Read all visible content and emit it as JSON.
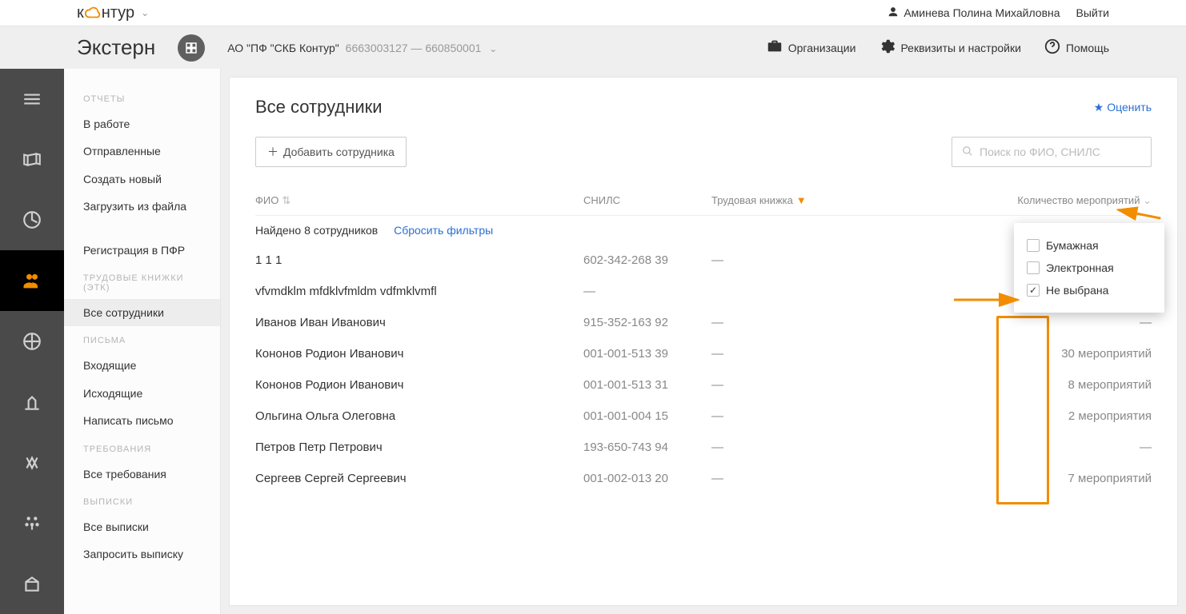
{
  "brand": {
    "pre": "к",
    "post": "нтур"
  },
  "topbar": {
    "user": "Аминева Полина Михайловна",
    "logout": "Выйти"
  },
  "appbar": {
    "app": "Экстерн",
    "org": "АО \"ПФ \"СКБ Контур\"",
    "codes": "6663003127 — 660850001",
    "links": {
      "orgs": "Организации",
      "req": "Реквизиты и настройки",
      "help": "Помощь"
    }
  },
  "sidebar": {
    "s1": {
      "title": "ОТЧЕТЫ",
      "items": [
        "В работе",
        "Отправленные",
        "Создать новый",
        "Загрузить из файла"
      ]
    },
    "s1b": {
      "items": [
        "Регистрация в ПФР"
      ]
    },
    "s2": {
      "title": "ТРУДОВЫЕ КНИЖКИ (ЭТК)",
      "items": [
        "Все сотрудники"
      ]
    },
    "s3": {
      "title": "ПИСЬМА",
      "items": [
        "Входящие",
        "Исходящие",
        "Написать письмо"
      ]
    },
    "s4": {
      "title": "ТРЕБОВАНИЯ",
      "items": [
        "Все требования"
      ]
    },
    "s5": {
      "title": "ВЫПИСКИ",
      "items": [
        "Все выписки",
        "Запросить выписку"
      ]
    }
  },
  "main": {
    "title": "Все сотрудники",
    "rate": "Оценить",
    "add": "Добавить сотрудника",
    "search_placeholder": "Поиск по ФИО, СНИЛС",
    "headers": {
      "fio": "ФИО",
      "snils": "СНИЛС",
      "tk": "Трудовая книжка",
      "cnt": "Количество мероприятий"
    },
    "found": "Найдено 8 сотрудников",
    "reset": "Сбросить фильтры",
    "rows": [
      {
        "fio": "1 1 1",
        "snils": "602-342-268 39",
        "tk": "—",
        "cnt": "—"
      },
      {
        "fio": "vfvmdklm mfdklvfmldm vdfmklvmfl",
        "snils": "—",
        "tk": "",
        "cnt": "—"
      },
      {
        "fio": "Иванов Иван Иванович",
        "snils": "915-352-163 92",
        "tk": "—",
        "cnt": "—"
      },
      {
        "fio": "Кононов Родион Иванович",
        "snils": "001-001-513 39",
        "tk": "—",
        "cnt": "30 мероприятий"
      },
      {
        "fio": "Кононов Родион Иванович",
        "snils": "001-001-513 31",
        "tk": "—",
        "cnt": "8 мероприятий"
      },
      {
        "fio": "Ольгина Ольга Олеговна",
        "snils": "001-001-004 15",
        "tk": "—",
        "cnt": "2 мероприятия"
      },
      {
        "fio": "Петров Петр Петрович",
        "snils": "193-650-743 94",
        "tk": "—",
        "cnt": "—"
      },
      {
        "fio": "Сергеев Сергей Сергеевич",
        "snils": "001-002-013 20",
        "tk": "—",
        "cnt": "7 мероприятий"
      }
    ],
    "filter": {
      "opt1": "Бумажная",
      "opt2": "Электронная",
      "opt3": "Не выбрана"
    }
  }
}
